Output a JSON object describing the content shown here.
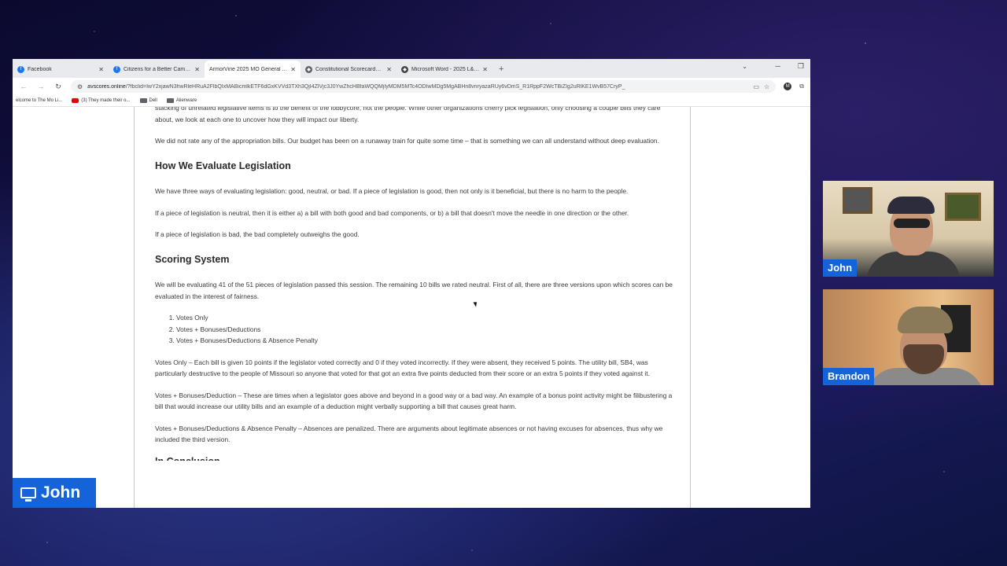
{
  "browser": {
    "tabs": [
      {
        "label": "Facebook",
        "icon": "facebook-icon",
        "active": false
      },
      {
        "label": "Citizens for a Better Camden Co",
        "icon": "facebook-icon",
        "active": false
      },
      {
        "label": "ArmorVine 2025 MO General Asser",
        "icon": "none",
        "active": true
      },
      {
        "label": "Constitutional Scorecards – Leg",
        "icon": "generic-icon",
        "active": false
      },
      {
        "label": "Microsoft Word - 2025 L&S Aw",
        "icon": "generic-icon",
        "active": false
      }
    ],
    "new_tab": "+",
    "url_domain": "avscores.online",
    "url_rest": "/?fbclid=IwY2xjawN3hwRleHRuA2FlbQIxMABicmlkETF6dGxKVVd3TXh3QjI4ZlVjc3J0YwZhcHBfaWQQMjIyMDM5MTc4ODIwMDg5MgABHn8vnryazaRUy6vDmS_R1RppF2WcTBiZIg2uRlKE1WvB57CryP_",
    "bookmarks": [
      {
        "label": "elcome to The Mo Li...",
        "icon": "none"
      },
      {
        "label": "(3) They made their o...",
        "icon": "youtube-icon"
      },
      {
        "label": "Dell",
        "icon": "folder-icon"
      },
      {
        "label": "Alienware",
        "icon": "folder-icon"
      }
    ]
  },
  "article": {
    "p_intro_tail": "stacking of unrelated legislative items is to the benefit of the lobbycore, not the people. While other organizations cherry pick legislation, only choosing a couple bills they care about, we look at each one to uncover how they will impact our liberty.",
    "p_appropriation": "We did not rate any of the appropriation bills. Our budget has been on a runaway train for quite some time – that is something we can all understand without deep evaluation.",
    "h_evaluate": "How We Evaluate Legislation",
    "p_three_ways": "We have three ways of evaluating legislation: good, neutral, or bad. If a piece of legislation is good, then not only is it beneficial, but there is no harm to the people.",
    "p_neutral": "If a piece of legislation is neutral, then it is either a) a bill with both good and bad components, or b) a bill that doesn't move the needle in one direction or the other.",
    "p_bad": "If a piece of legislation is bad, the bad completely outweighs the good.",
    "h_scoring": "Scoring System",
    "p_scoring": "We will be evaluating 41 of the 51 pieces of legislation passed this session. The remaining 10 bills we rated neutral. First of all, there are three versions upon which scores can be evaluated in the interest of fairness.",
    "versions": [
      "Votes Only",
      "Votes + Bonuses/Deductions",
      "Votes + Bonuses/Deductions & Absence Penalty"
    ],
    "p_votes_only": "Votes Only – Each bill is given 10 points if the legislator voted correctly and 0 if they voted incorrectly. If they were absent, they received 5 points. The utility bill, SB4, was particularly destructive to the people of Missouri so anyone that voted for that got an extra five points deducted from their score or an extra 5 points if they voted against it.",
    "p_bonuses": "Votes + Bonuses/Deduction – These are times when a legislator goes above and beyond in a good way or a bad way. An example of a bonus point activity might be filibustering a bill that would increase our utility bills and an example of a deduction might verbally supporting a bill that causes great harm.",
    "p_absence": "Votes + Bonuses/Deductions & Absence Penalty – Absences are penalized. There are arguments about legitimate absences or not having excuses for absences, thus why we included the third version.",
    "h_cut": "In Conclusion"
  },
  "participants": [
    {
      "name": "John"
    },
    {
      "name": "Brandon"
    }
  ],
  "screen_share_label": "John",
  "colors": {
    "label_blue": "#1463d8"
  }
}
